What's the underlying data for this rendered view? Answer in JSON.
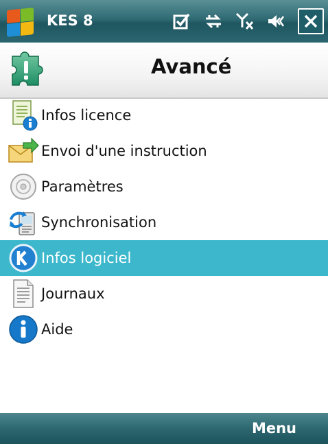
{
  "statusbar": {
    "app_title": "KES 8",
    "icons": [
      "start-icon",
      "notification-icon",
      "connectivity-icon",
      "signal-off-icon",
      "volume-icon",
      "close-icon"
    ]
  },
  "header": {
    "title": "Avancé",
    "icon": "puzzle-warning-icon"
  },
  "menu_items": [
    {
      "label": "Infos licence",
      "icon": "license-info-icon"
    },
    {
      "label": "Envoi d'une instruction",
      "icon": "send-mail-icon"
    },
    {
      "label": "Paramètres",
      "icon": "settings-icon"
    },
    {
      "label": "Synchronisation",
      "icon": "sync-icon"
    },
    {
      "label": "Infos logiciel",
      "icon": "kaspersky-icon",
      "selected": true
    },
    {
      "label": "Journaux",
      "icon": "logs-icon"
    },
    {
      "label": "Aide",
      "icon": "help-icon"
    }
  ],
  "softkeys": {
    "right_label": "Menu"
  },
  "colors": {
    "bar": "#2f6a73",
    "selected": "#3cb7cc"
  }
}
